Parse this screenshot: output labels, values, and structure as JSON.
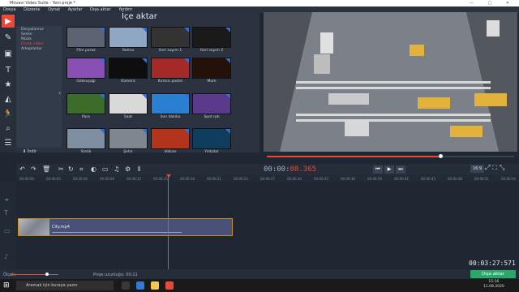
{
  "window": {
    "title": "Movavi Video Suite - Yeni proje *"
  },
  "menu": [
    "Dosya",
    "Düzenle",
    "Oynat",
    "Ayarlar",
    "Dışa aktar",
    "Yardım"
  ],
  "import_panel": {
    "title": "İçe aktar",
    "categories": [
      "Dosyalarınız",
      "Sesler",
      "Müzik",
      "Örnek video",
      "Arkaplanlar"
    ],
    "selected_category": "Örnek video",
    "import_button": "İndir",
    "thumbnails": [
      {
        "label": "Film paraz",
        "color": "#5b6470"
      },
      {
        "label": "Retina",
        "color": "#8fa7c2"
      },
      {
        "label": "Geri sayım 1",
        "color": "#333"
      },
      {
        "label": "Geri sayım 2",
        "color": "#1a1a1a"
      },
      {
        "label": "Gökkuşağı",
        "color": "#8a4fb3"
      },
      {
        "label": "Kamera",
        "color": "#0e0e0e"
      },
      {
        "label": "Kırmızı pastel",
        "color": "#a42a2a"
      },
      {
        "label": "Mum",
        "color": "#241208"
      },
      {
        "label": "Para",
        "color": "#3c6c2c"
      },
      {
        "label": "Saat",
        "color": "#d9d9d9"
      },
      {
        "label": "Son dakika",
        "color": "#2a7fd0"
      },
      {
        "label": "Spot ışık",
        "color": "#5a3a8a"
      },
      {
        "label": "Statik",
        "color": "#7f8ea1"
      },
      {
        "label": "Şehir",
        "color": "#7e878f"
      },
      {
        "label": "Volkan",
        "color": "#b3341c"
      },
      {
        "label": "Yıldızlar",
        "color": "#0f3d5e"
      }
    ]
  },
  "player": {
    "timecode_white": "00:00:",
    "timecode_red": "08.365",
    "aspect_ratio": "16:9",
    "seek_progress": 0.7
  },
  "ruler_ticks": [
    "00:00:00",
    "00:00:03",
    "00:00:06",
    "00:00:09",
    "00:00:12",
    "00:00:15",
    "00:00:18",
    "00:00:21",
    "00:00:24",
    "00:00:27",
    "00:00:30",
    "00:00:33",
    "00:00:36",
    "00:00:39",
    "00:00:42",
    "00:00:45",
    "00:00:48",
    "00:00:51",
    "00:00:54",
    "00:00:57"
  ],
  "timeline": {
    "clip_name": "City.mp4",
    "duration": "00:03:27:571"
  },
  "status": {
    "zoom_label": "Ölçek:",
    "project_duration": "Proje uzunluğu:  00:11",
    "export_button": "Dışa aktar"
  },
  "taskbar": {
    "search_placeholder": "Aramak için buraya yazın",
    "time": "15:16",
    "date": "11.08.2020"
  },
  "colors": {
    "accent": "#e8493a",
    "export": "#2aa86a"
  }
}
